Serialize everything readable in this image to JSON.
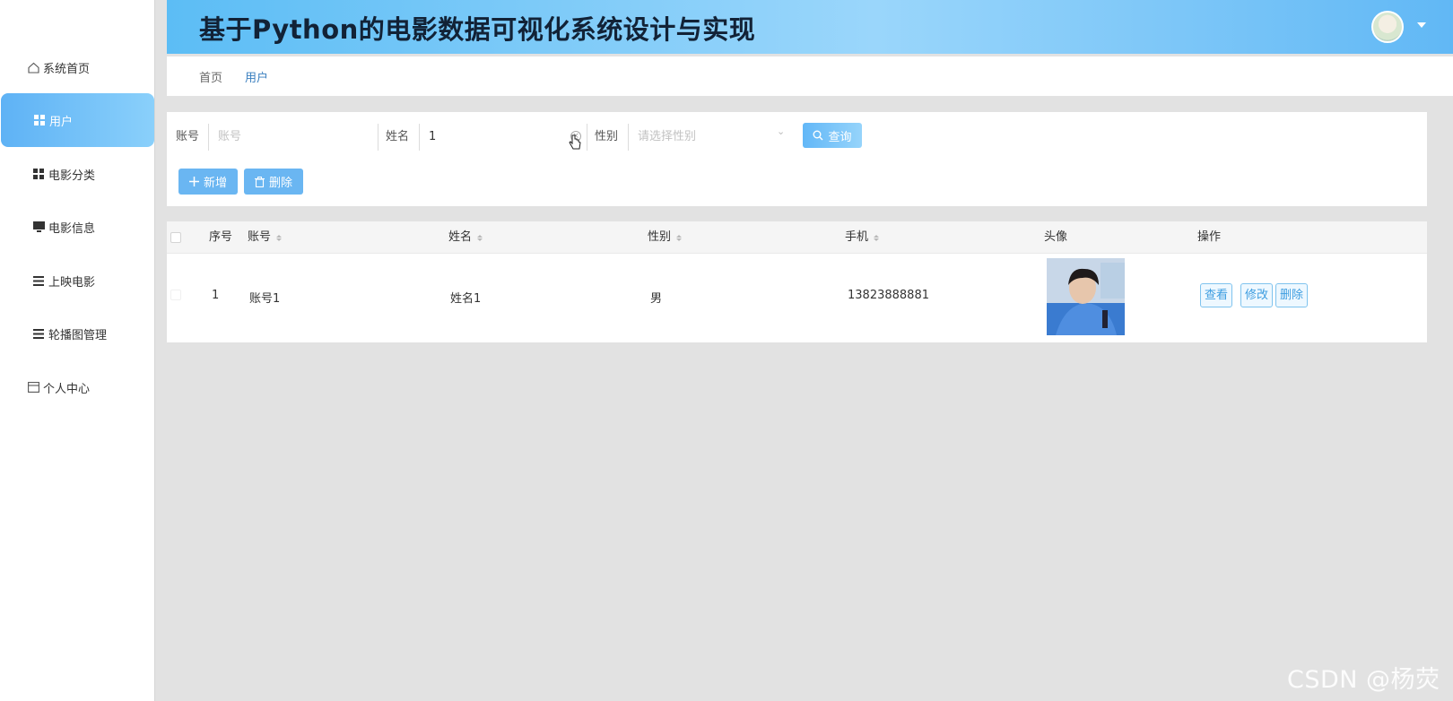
{
  "header": {
    "title": "基于Python的电影数据可视化系统设计与实现"
  },
  "sidebar": {
    "items": [
      {
        "label": "系统首页",
        "icon": "home-icon"
      },
      {
        "label": "用户",
        "icon": "grid-icon",
        "active": true
      },
      {
        "label": "电影分类",
        "icon": "grid-icon"
      },
      {
        "label": "电影信息",
        "icon": "monitor-icon"
      },
      {
        "label": "上映电影",
        "icon": "list-icon"
      },
      {
        "label": "轮播图管理",
        "icon": "list-icon"
      },
      {
        "label": "个人中心",
        "icon": "card-icon"
      }
    ]
  },
  "breadcrumb": {
    "home": "首页",
    "current": "用户"
  },
  "search": {
    "account_label": "账号",
    "account_placeholder": "账号",
    "name_label": "姓名",
    "name_value": "1",
    "gender_label": "性别",
    "gender_placeholder": "请选择性别",
    "query_label": "查询"
  },
  "actions": {
    "add_label": "新增",
    "delete_label": "删除"
  },
  "table": {
    "columns": [
      "序号",
      "账号",
      "姓名",
      "性别",
      "手机",
      "头像",
      "操作"
    ],
    "rows": [
      {
        "index": "1",
        "account": "账号1",
        "name": "姓名1",
        "gender": "男",
        "phone": "13823888881"
      }
    ],
    "row_actions": [
      "查看",
      "修改",
      "删除"
    ]
  },
  "watermark": "CSDN @杨荧",
  "colors": {
    "accent": "#5eb2f5",
    "header_text": "#122236",
    "link": "#3d9de0"
  }
}
